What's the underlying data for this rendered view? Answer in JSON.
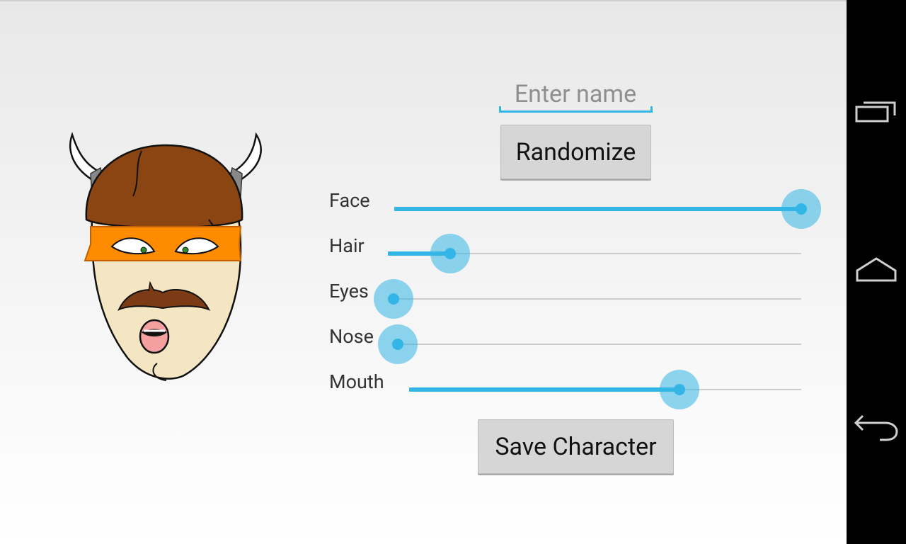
{
  "form": {
    "name_placeholder": "Enter name",
    "randomize_label": "Randomize",
    "save_label": "Save Character"
  },
  "sliders": [
    {
      "label": "Face",
      "value": 1.0
    },
    {
      "label": "Hair",
      "value": 0.15
    },
    {
      "label": "Eyes",
      "value": 0.0
    },
    {
      "label": "Nose",
      "value": 0.0
    },
    {
      "label": "Mouth",
      "value": 0.69
    }
  ],
  "colors": {
    "accent": "#33b5e5",
    "skin": "#f5e6c3",
    "helmet": "#8b4513",
    "mask": "#ff8c00",
    "mustache": "#7a3b15",
    "mouth": "#f4a0a0"
  },
  "navigation": {
    "recents_icon": "recent-apps-icon",
    "home_icon": "home-icon",
    "back_icon": "back-icon"
  }
}
